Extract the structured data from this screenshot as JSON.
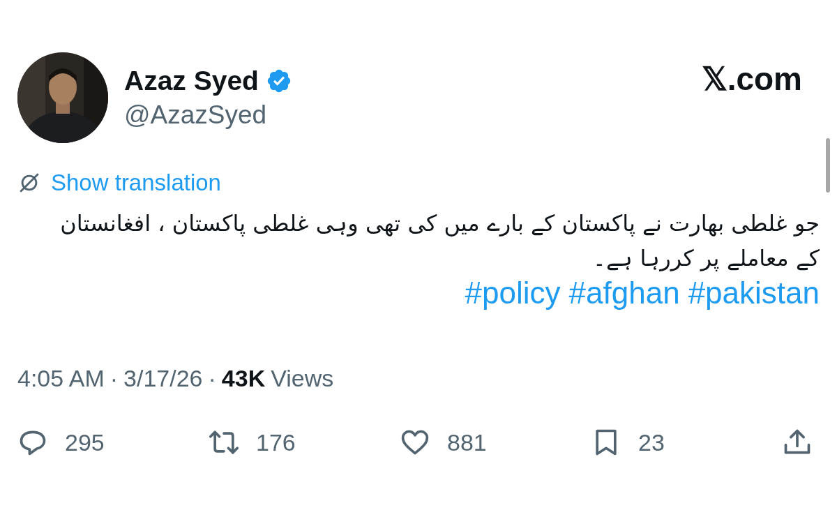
{
  "author": {
    "name": "Azaz Syed",
    "verified": true,
    "handle": "@AzazSyed"
  },
  "site": "𝕏.com",
  "translate": {
    "label": "Show translation"
  },
  "text": "جو غلطی بھارت نے پاکستان کے بارے میں کی تھی وہی غلطی پاکستان ، افغانستان کے معاملے پر کررہا ہے۔",
  "hashtags": [
    "#policy",
    "#afghan",
    "#pakistan"
  ],
  "meta": {
    "time": "4:05 AM",
    "separator_1": "·",
    "date": "3/17/26",
    "separator_2": "·",
    "views_count": "43K",
    "views_label": "Views"
  },
  "actions": [
    {
      "kind": "reply",
      "count": "295"
    },
    {
      "kind": "repost",
      "count": "176"
    },
    {
      "kind": "like",
      "count": "881"
    },
    {
      "kind": "bookmark",
      "count": "23"
    },
    {
      "kind": "share"
    }
  ]
}
